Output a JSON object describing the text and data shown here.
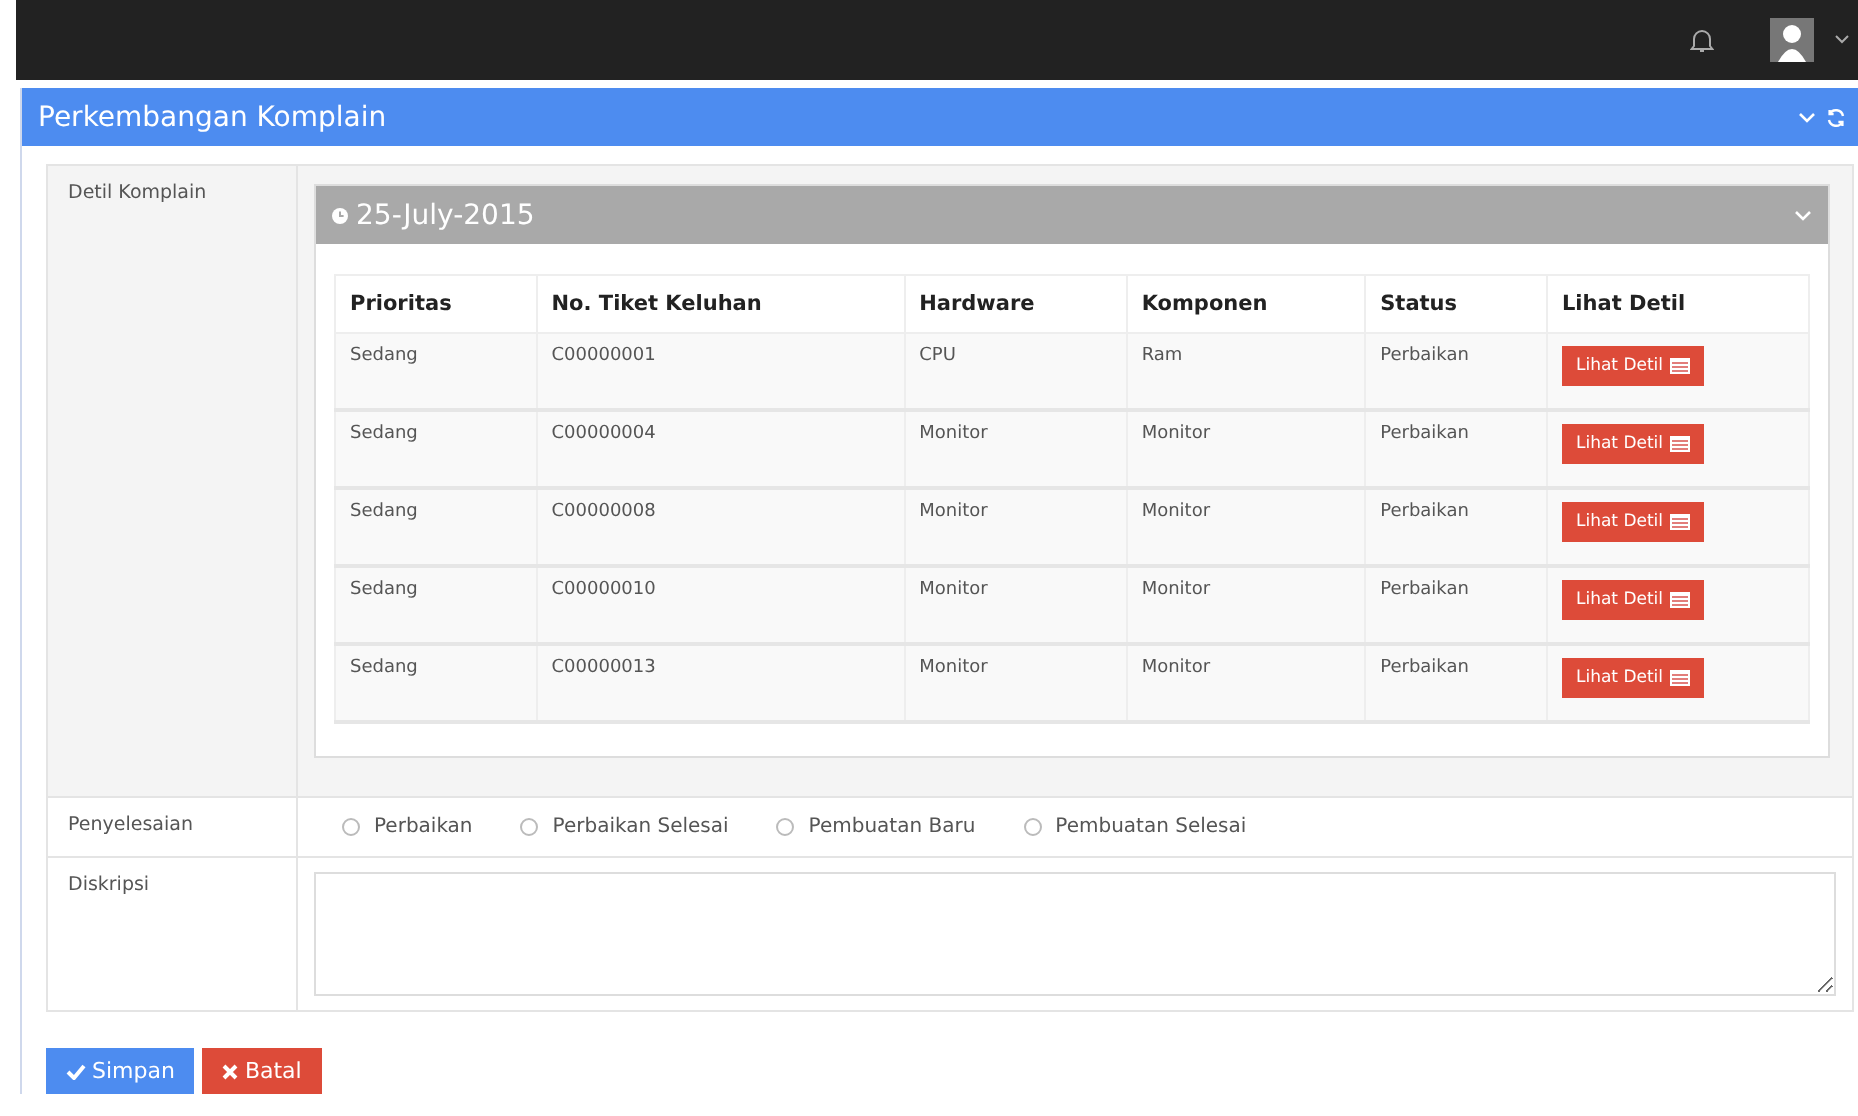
{
  "panel": {
    "title": "Perkembangan Komplain"
  },
  "detail": {
    "label": "Detil Komplain",
    "date": "25-July-2015",
    "expanded": true,
    "columns": [
      "Prioritas",
      "No. Tiket Keluhan",
      "Hardware",
      "Komponen",
      "Status",
      "Lihat Detil"
    ],
    "rows": [
      {
        "priority": "Sedang",
        "ticket": "C00000001",
        "hardware": "CPU",
        "component": "Ram",
        "status": "Perbaikan",
        "action": "Lihat Detil"
      },
      {
        "priority": "Sedang",
        "ticket": "C00000004",
        "hardware": "Monitor",
        "component": "Monitor",
        "status": "Perbaikan",
        "action": "Lihat Detil"
      },
      {
        "priority": "Sedang",
        "ticket": "C00000008",
        "hardware": "Monitor",
        "component": "Monitor",
        "status": "Perbaikan",
        "action": "Lihat Detil"
      },
      {
        "priority": "Sedang",
        "ticket": "C00000010",
        "hardware": "Monitor",
        "component": "Monitor",
        "status": "Perbaikan",
        "action": "Lihat Detil"
      },
      {
        "priority": "Sedang",
        "ticket": "C00000013",
        "hardware": "Monitor",
        "component": "Monitor",
        "status": "Perbaikan",
        "action": "Lihat Detil"
      }
    ]
  },
  "resolution": {
    "label": "Penyelesaian",
    "options": [
      {
        "label": "Perbaikan",
        "selected": false
      },
      {
        "label": "Perbaikan Selesai",
        "selected": false
      },
      {
        "label": "Pembuatan Baru",
        "selected": false
      },
      {
        "label": "Pembuatan Selesai",
        "selected": false
      }
    ]
  },
  "description": {
    "label": "Diskripsi"
  },
  "buttons": [
    {
      "label": "Simpan",
      "kind": "save"
    },
    {
      "label": "Batal",
      "kind": "cancel"
    }
  ]
}
